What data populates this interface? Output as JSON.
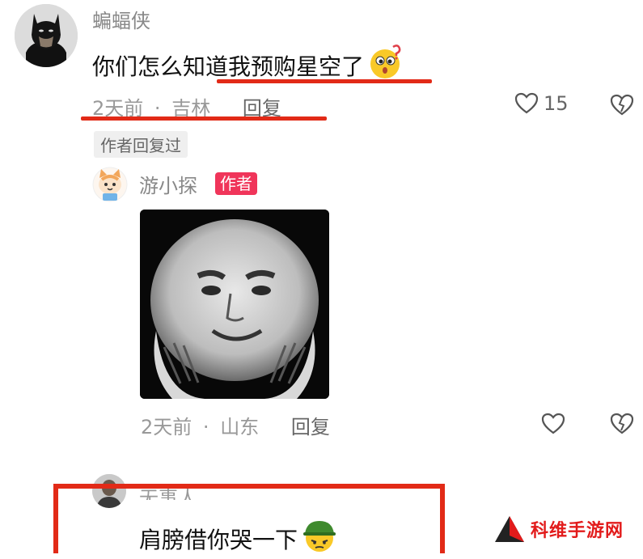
{
  "comments": [
    {
      "username": "蝙蝠侠",
      "text": "你们怎么知道我预购星空了",
      "time": "2天前",
      "location": "吉林",
      "reply_label": "回复",
      "likes": "15",
      "author_replied_tag": "作者回复过"
    },
    {
      "username": "游小探",
      "author_badge": "作者",
      "time": "2天前",
      "location": "山东",
      "reply_label": "回复"
    },
    {
      "username": "无事人",
      "text": "肩膀借你哭一下"
    }
  ],
  "meta_separator": "·",
  "watermark": {
    "text": "科维手游网"
  },
  "colors": {
    "highlight_red": "#e22a17",
    "author_badge": "#f0355a"
  }
}
